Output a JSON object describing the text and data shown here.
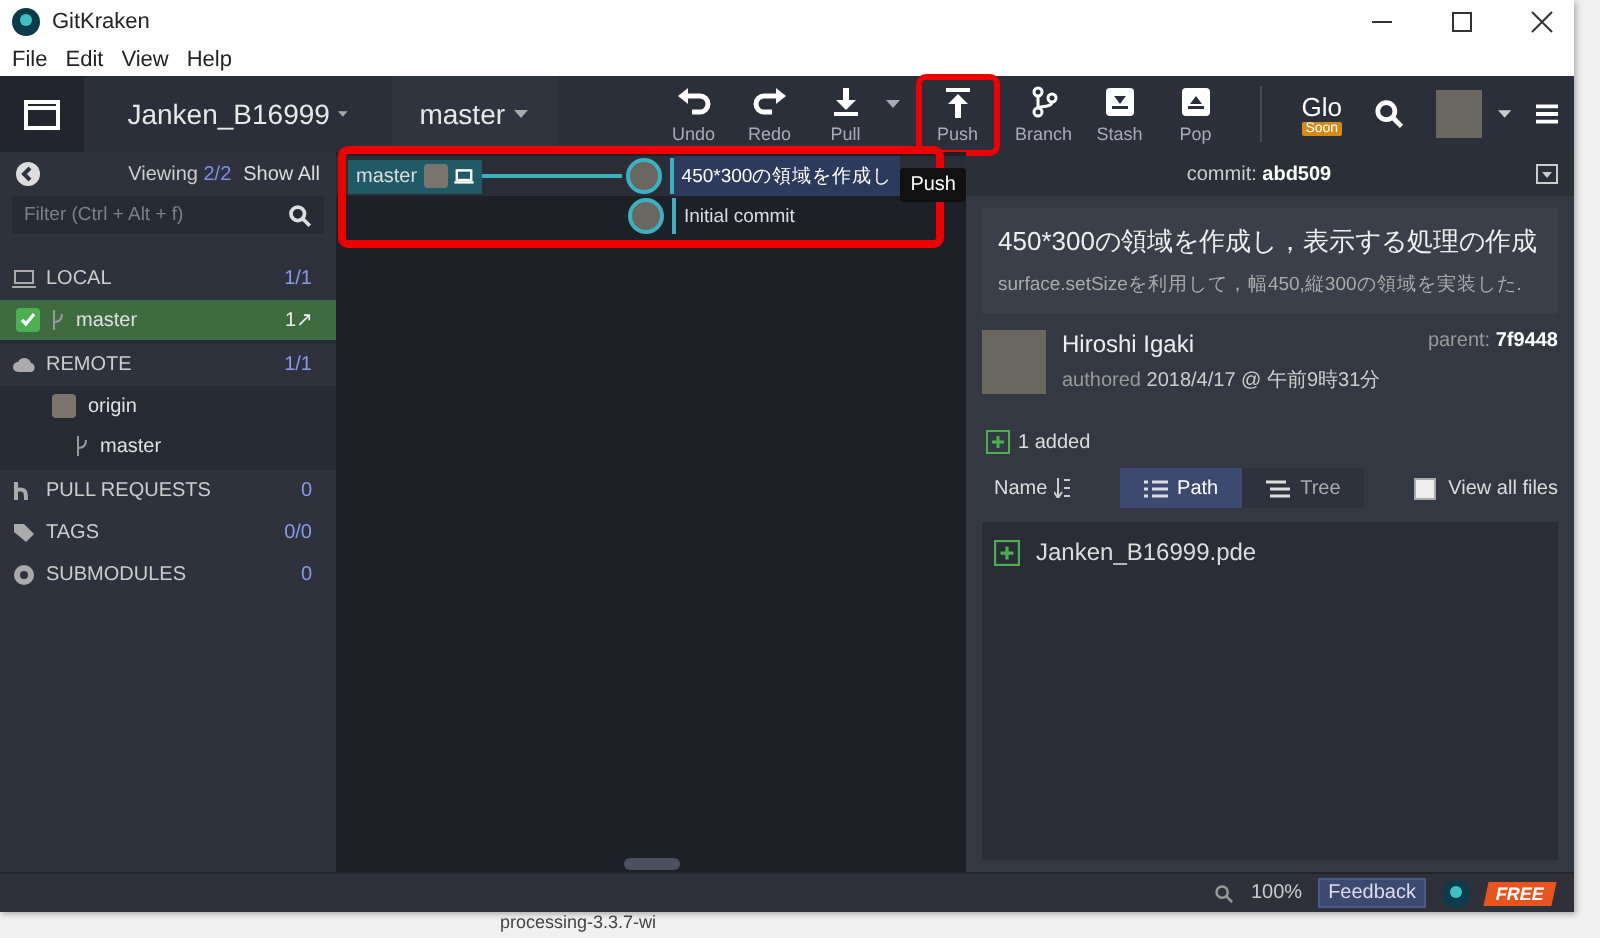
{
  "window": {
    "title": "GitKraken"
  },
  "menu": [
    "File",
    "Edit",
    "View",
    "Help"
  ],
  "toolbar": {
    "repo": "Janken_B16999",
    "branch": "master",
    "actions": [
      {
        "label": "Undo",
        "kind": "undo"
      },
      {
        "label": "Redo",
        "kind": "redo"
      },
      {
        "label": "Pull",
        "kind": "pull"
      },
      {
        "label": "Push",
        "kind": "push"
      },
      {
        "label": "Branch",
        "kind": "branch"
      },
      {
        "label": "Stash",
        "kind": "stash"
      },
      {
        "label": "Pop",
        "kind": "pop"
      }
    ],
    "glo": {
      "label": "Glo",
      "badge": "Soon"
    },
    "tooltip": "Push"
  },
  "sidebar": {
    "viewing_label": "Viewing",
    "viewing_count": "2/2",
    "show_all": "Show All",
    "filter_placeholder": "Filter (Ctrl + Alt + f)",
    "sections": [
      {
        "kind": "local",
        "label": "LOCAL",
        "count": "1/1",
        "children": [
          {
            "label": "master",
            "count": "1↗",
            "selected": true,
            "checked": true
          }
        ]
      },
      {
        "kind": "remote",
        "label": "REMOTE",
        "count": "1/1",
        "children": [
          {
            "label": "origin",
            "children": [
              {
                "label": "master"
              }
            ]
          }
        ]
      },
      {
        "kind": "pulls",
        "label": "PULL REQUESTS",
        "count": "0"
      },
      {
        "kind": "tags",
        "label": "TAGS",
        "count": "0/0"
      },
      {
        "kind": "submodules",
        "label": "SUBMODULES",
        "count": "0"
      }
    ]
  },
  "graph": {
    "rows": [
      {
        "branch": "master",
        "message": "450*300の領域を作成し",
        "selected": true
      },
      {
        "message": "Initial commit",
        "selected": false
      }
    ]
  },
  "detail": {
    "commit_label": "commit:",
    "commit_id": "abd509",
    "summary": "450*300の領域を作成し，表示する処理の作成",
    "description": "surface.setSizeを利用して，幅450,縦300の領域を実装した.",
    "author": "Hiroshi Igaki",
    "authored_label": "authored",
    "date": "2018/4/17 @ 午前9時31分",
    "parent_label": "parent:",
    "parent": "7f9448",
    "added": "1 added",
    "sort_label": "Name",
    "views": [
      {
        "label": "Path",
        "selected": true
      },
      {
        "label": "Tree",
        "selected": false
      }
    ],
    "view_all": {
      "label": "View all files",
      "checked": false
    },
    "files": [
      "Janken_B16999.pde"
    ]
  },
  "status": {
    "zoom": "100%",
    "feedback": "Feedback",
    "plan": "FREE"
  },
  "taskbar": {
    "item": "processing-3.3.7-wi"
  }
}
